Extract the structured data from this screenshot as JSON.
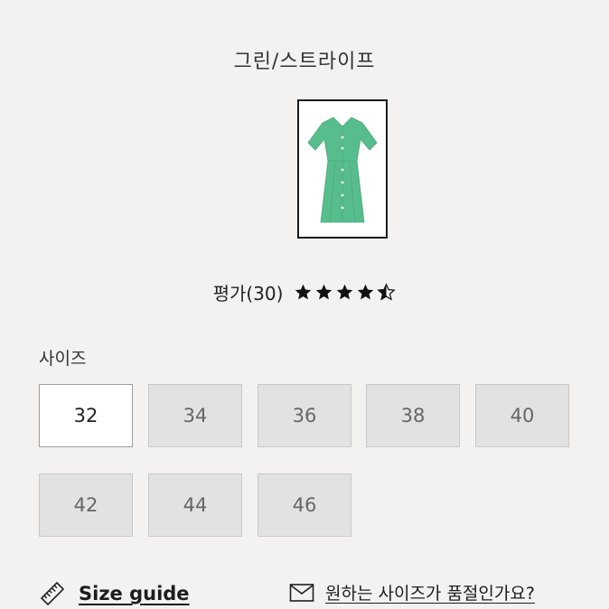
{
  "variant": {
    "color_name": "그린/스트라이프"
  },
  "swatch": {
    "color": "#58bd8c"
  },
  "rating": {
    "label": "평가(30)",
    "stars": 4.5,
    "star_color": "#111111"
  },
  "size_section": {
    "heading": "사이즈",
    "sizes": [
      {
        "label": "32",
        "selected": true
      },
      {
        "label": "34",
        "selected": false
      },
      {
        "label": "36",
        "selected": false
      },
      {
        "label": "38",
        "selected": false
      },
      {
        "label": "40",
        "selected": false
      },
      {
        "label": "42",
        "selected": false
      },
      {
        "label": "44",
        "selected": false
      },
      {
        "label": "46",
        "selected": false
      }
    ]
  },
  "links": {
    "size_guide": "Size guide",
    "out_of_stock": "원하는 사이즈가 품절인가요?"
  }
}
